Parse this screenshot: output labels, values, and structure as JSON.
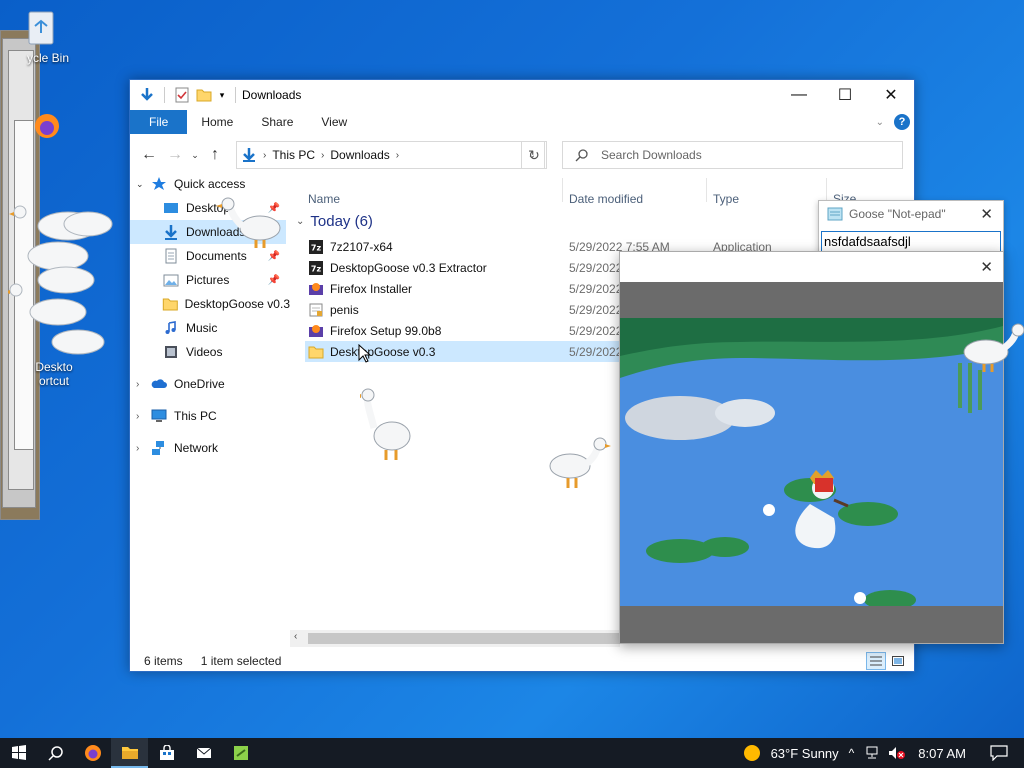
{
  "desktop": {
    "icons": [
      {
        "label": "ycle Bin"
      },
      {
        "label": "Deskto"
      },
      {
        "label": "ortcut"
      }
    ]
  },
  "explorer": {
    "title": "Downloads",
    "tabs": [
      "File",
      "Home",
      "Share",
      "View"
    ],
    "address": [
      "This PC",
      "Downloads"
    ],
    "search_placeholder": "Search Downloads",
    "sidebar": [
      {
        "label": "Quick access",
        "icon": "star-icon"
      },
      {
        "label": "Desktop",
        "icon": "desktop-folder-icon",
        "pinned": true
      },
      {
        "label": "Downloads",
        "icon": "download-folder-icon",
        "pinned": true,
        "selected": true
      },
      {
        "label": "Documents",
        "icon": "documents-folder-icon",
        "pinned": true
      },
      {
        "label": "Pictures",
        "icon": "pictures-folder-icon",
        "pinned": true
      },
      {
        "label": "DesktopGoose v0.3",
        "icon": "folder-icon"
      },
      {
        "label": "Music",
        "icon": "music-folder-icon"
      },
      {
        "label": "Videos",
        "icon": "videos-folder-icon"
      },
      {
        "label": "OneDrive",
        "icon": "cloud-icon"
      },
      {
        "label": "This PC",
        "icon": "computer-icon"
      },
      {
        "label": "Network",
        "icon": "network-icon"
      }
    ],
    "columns": {
      "name": "Name",
      "date": "Date modified",
      "type": "Type",
      "size": "Size"
    },
    "group": "Today (6)",
    "files": [
      {
        "name": "7z2107-x64",
        "date": "5/29/2022 7:55 AM",
        "type": "Application",
        "icon": "7zip-icon"
      },
      {
        "name": "DesktopGoose v0.3 Extractor",
        "date": "5/29/2022",
        "type": "",
        "icon": "7zip-icon"
      },
      {
        "name": "Firefox Installer",
        "date": "5/29/2022",
        "type": "",
        "icon": "firefox-installer-icon"
      },
      {
        "name": "penis",
        "date": "5/29/2022",
        "type": "",
        "icon": "text-file-icon"
      },
      {
        "name": "Firefox Setup 99.0b8",
        "date": "5/29/2022",
        "type": "",
        "icon": "firefox-installer-icon"
      },
      {
        "name": "DesktopGoose v0.3",
        "date": "5/29/2022",
        "type": "",
        "icon": "folder-icon",
        "selected": true
      }
    ],
    "status": {
      "count": "6 items",
      "selection": "1 item selected"
    }
  },
  "notepad": {
    "title": "Goose \"Not-epad\"",
    "text": "nsfdafdsaafsdjl"
  },
  "taskbar": {
    "weather": "63°F  Sunny",
    "time": "8:07 AM"
  },
  "colors": {
    "accent": "#1a73c9",
    "selection": "#cce8ff",
    "taskbar": "#151b24"
  }
}
